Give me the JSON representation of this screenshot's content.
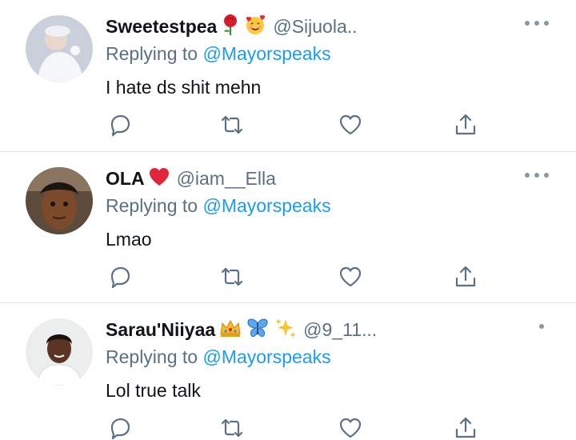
{
  "tweets": [
    {
      "display_name": "Sweetestpea",
      "emojis": [
        "rose-emoji",
        "smiling-face-with-hearts-emoji"
      ],
      "handle": "@Sijuola..",
      "replying_prefix": "Replying to",
      "replying_mention": "@Mayorspeaks",
      "text": "I hate ds shit mehn"
    },
    {
      "display_name": "OLA",
      "emojis": [
        "red-heart-emoji"
      ],
      "handle": "@iam__Ella",
      "replying_prefix": "Replying to",
      "replying_mention": "@Mayorspeaks",
      "text": "Lmao"
    },
    {
      "display_name": "Sarau'Niiyaa",
      "emojis": [
        "crown-emoji",
        "butterfly-emoji",
        "sparkles-emoji"
      ],
      "handle": "@9_11...",
      "replying_prefix": "Replying to",
      "replying_mention": "@Mayorspeaks",
      "text": "Lol true talk"
    }
  ],
  "icons": {
    "reply": "reply-icon",
    "retweet": "retweet-icon",
    "like": "like-icon",
    "share": "share-icon",
    "more": "more-icon"
  },
  "colors": {
    "text": "#0f1419",
    "secondary": "#5b7083",
    "link": "#1d9bf0",
    "icon": "#5b7083",
    "divider": "#e1e6ea"
  }
}
